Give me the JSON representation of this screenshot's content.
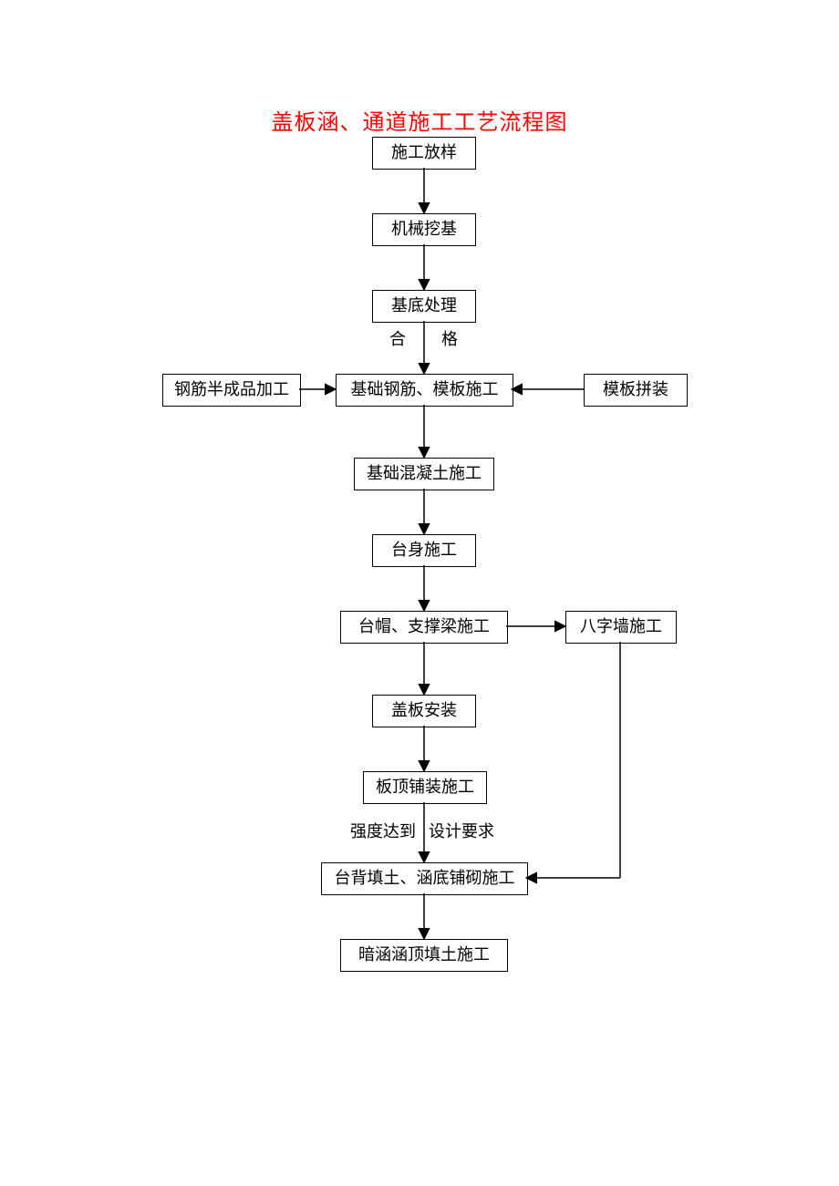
{
  "title": "盖板涵、通道施工工艺流程图",
  "nodes": {
    "n1": "施工放样",
    "n2": "机械挖基",
    "n3": "基底处理",
    "label_qualified_left": "合",
    "label_qualified_right": "格",
    "side_left": "钢筋半成品加工",
    "n4": "基础钢筋、模板施工",
    "side_right": "模板拼装",
    "n5": "基础混凝土施工",
    "n6": "台身施工",
    "n7": "台帽、支撑梁施工",
    "side_wall": "八字墙施工",
    "n8": "盖板安装",
    "n9": "板顶铺装施工",
    "label_strength_left": "强度达到",
    "label_strength_right": "设计要求",
    "n10": "台背填土、涵底铺砌施工",
    "n11": "暗涵涵顶填土施工"
  }
}
